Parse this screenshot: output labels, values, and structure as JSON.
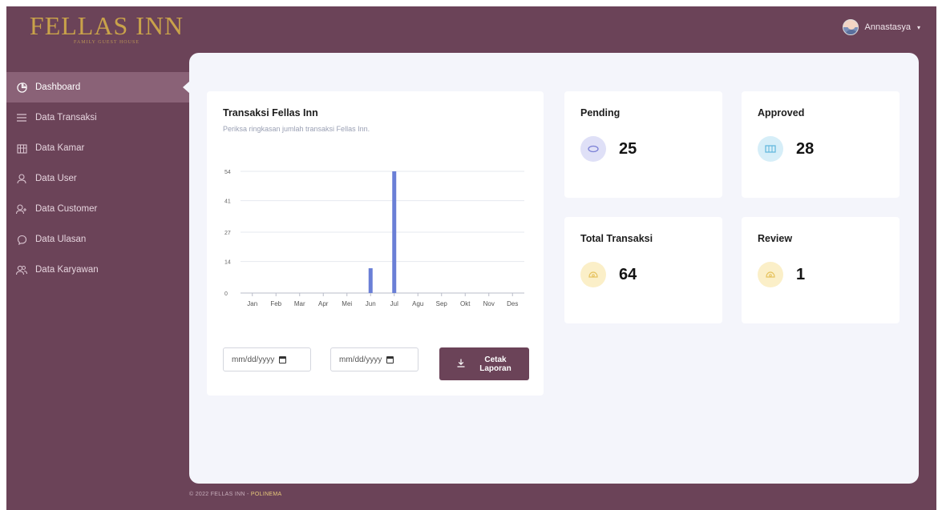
{
  "brand": {
    "name": "FELLAS INN",
    "tagline": "FAMILY GUEST HOUSE"
  },
  "user": {
    "name": "Annastasya",
    "caret": "▾"
  },
  "sidebar": {
    "items": [
      {
        "label": "Dashboard",
        "icon": "pie-chart-icon",
        "active": true
      },
      {
        "label": "Data Transaksi",
        "icon": "list-icon"
      },
      {
        "label": "Data Kamar",
        "icon": "bed-icon"
      },
      {
        "label": "Data User",
        "icon": "user-icon"
      },
      {
        "label": "Data Customer",
        "icon": "user-plus-icon"
      },
      {
        "label": "Data Ulasan",
        "icon": "chat-bubble-icon"
      },
      {
        "label": "Data Karyawan",
        "icon": "users-icon"
      }
    ]
  },
  "chart_card": {
    "title": "Transaksi Fellas Inn",
    "subtitle": "Periksa ringkasan jumlah transaksi Fellas Inn.",
    "date_from_placeholder": "mm/dd/yyyy",
    "date_to_placeholder": "mm/dd/yyyy",
    "button_line1": "Cetak",
    "button_line2": "Laporan"
  },
  "chart_data": {
    "type": "bar",
    "categories": [
      "Jan",
      "Feb",
      "Mar",
      "Apr",
      "Mei",
      "Jun",
      "Jul",
      "Agu",
      "Sep",
      "Okt",
      "Nov",
      "Des"
    ],
    "values": [
      0,
      0,
      0,
      0,
      0,
      11,
      54,
      0,
      0,
      0,
      0,
      0
    ],
    "yticks": [
      0,
      14,
      27,
      41,
      54
    ],
    "ylim": [
      0,
      54
    ],
    "grid": true,
    "color": "#6a7fd6",
    "title": "",
    "xlabel": "",
    "ylabel": ""
  },
  "stats": {
    "pending": {
      "title": "Pending",
      "value": "25",
      "icon": "cloud-icon",
      "bg": "#dfe0f7",
      "fg": "#7b80d6"
    },
    "approved": {
      "title": "Approved",
      "value": "28",
      "icon": "table-icon",
      "bg": "#d6eef8",
      "fg": "#5db5dc"
    },
    "total": {
      "title": "Total Transaksi",
      "value": "64",
      "icon": "money-icon",
      "bg": "#fbefc8",
      "fg": "#e6c25d"
    },
    "review": {
      "title": "Review",
      "value": "1",
      "icon": "money-icon",
      "bg": "#fbefc8",
      "fg": "#e6c25d"
    }
  },
  "footer": {
    "prefix": "© 2022 FELLAS INN - ",
    "link": "POLINEMA"
  },
  "colors": {
    "primary": "#6b4358",
    "sidebar_active": "#8a6277",
    "panel_bg": "#f4f5fb",
    "bar": "#6a7fd6"
  }
}
